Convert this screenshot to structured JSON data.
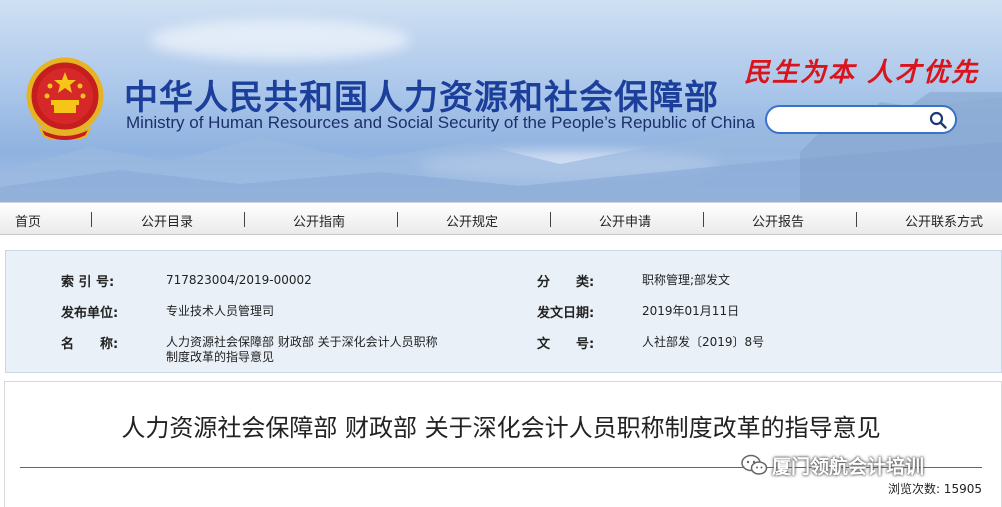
{
  "header": {
    "title_cn": "中华人民共和国人力资源和社会保障部",
    "title_en": "Ministry of Human Resources and Social Security of the People’s Republic of China",
    "slogan": "民生为本 人才优先",
    "search": {
      "placeholder": "",
      "value": ""
    }
  },
  "nav": {
    "items": [
      "首页",
      "公开目录",
      "公开指南",
      "公开规定",
      "公开申请",
      "公开报告",
      "公开联系方式"
    ]
  },
  "info": {
    "index_label": "索 引 号:",
    "index_value": "717823004/2019-00002",
    "category_label": "分　　类:",
    "category_value": "职称管理;部发文",
    "issuer_label": "发布单位:",
    "issuer_value": "专业技术人员管理司",
    "date_label": "发文日期:",
    "date_value": "2019年01月11日",
    "name_label": "名　　称:",
    "name_value_line1": "人力资源社会保障部 财政部 关于深化会计人员职称",
    "name_value_line2": "制度改革的指导意见",
    "docno_label": "文　　号:",
    "docno_value": "人社部发〔2019〕8号"
  },
  "article": {
    "title": "人力资源社会保障部  财政部  关于深化会计人员职称制度改革的指导意见",
    "views": "浏览次数: 15905"
  },
  "watermark": {
    "text": "厦门领航会计培训"
  },
  "colors": {
    "brand_blue": "#1b3f9b",
    "slogan_red": "#d9141c",
    "rule_red": "#c93a3a"
  }
}
